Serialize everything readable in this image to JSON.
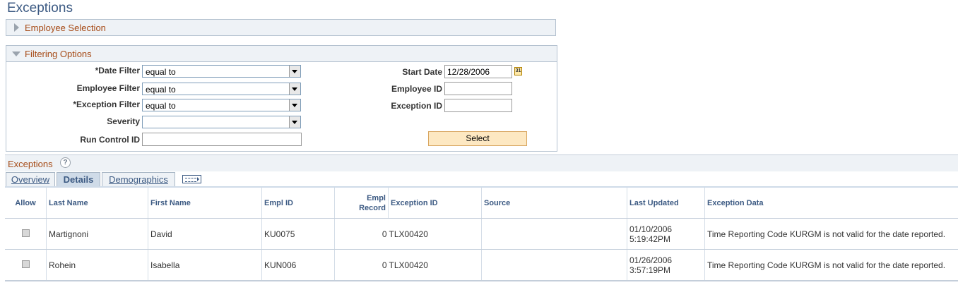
{
  "page": {
    "title": "Exceptions"
  },
  "employee_selection": {
    "label": "Employee Selection"
  },
  "filtering_options": {
    "label": "Filtering Options",
    "date_filter": {
      "label": "*Date Filter",
      "value": "equal to"
    },
    "employee_filter": {
      "label": "Employee Filter",
      "value": "equal to"
    },
    "exception_filter": {
      "label": "*Exception Filter",
      "value": "equal to"
    },
    "severity": {
      "label": "Severity",
      "value": ""
    },
    "run_control_id": {
      "label": "Run Control ID",
      "value": ""
    },
    "start_date": {
      "label": "Start Date",
      "value": "12/28/2006",
      "calendar_icon_text": "31"
    },
    "employee_id": {
      "label": "Employee ID",
      "value": ""
    },
    "exception_id": {
      "label": "Exception ID",
      "value": ""
    },
    "select_button": "Select"
  },
  "exceptions": {
    "label": "Exceptions",
    "help_icon_text": "?",
    "tabs": [
      {
        "label": "Overview",
        "active": false
      },
      {
        "label": "Details",
        "active": true
      },
      {
        "label": "Demographics",
        "active": false
      }
    ],
    "columns": {
      "allow": "Allow",
      "last_name": "Last Name",
      "first_name": "First Name",
      "empl_id": "Empl ID",
      "empl_record_1": "Empl",
      "empl_record_2": "Record",
      "exception_id": "Exception ID",
      "source": "Source",
      "last_updated": "Last Updated",
      "exception_data": "Exception Data"
    },
    "rows": [
      {
        "last_name": "Martignoni",
        "first_name": "David",
        "empl_id": "KU0075",
        "empl_record": "0",
        "exception_id": "TLX00420",
        "source": "",
        "last_updated_date": "01/10/2006",
        "last_updated_time": "5:19:42PM",
        "exception_data": "Time Reporting Code KURGM is not valid for the date reported."
      },
      {
        "last_name": "Rohein",
        "first_name": "Isabella",
        "empl_id": "KUN006",
        "empl_record": "0",
        "exception_id": "TLX00420",
        "source": "",
        "last_updated_date": "01/26/2006",
        "last_updated_time": "3:57:19PM",
        "exception_data": "Time Reporting Code KURGM is not valid for the date reported."
      }
    ]
  }
}
